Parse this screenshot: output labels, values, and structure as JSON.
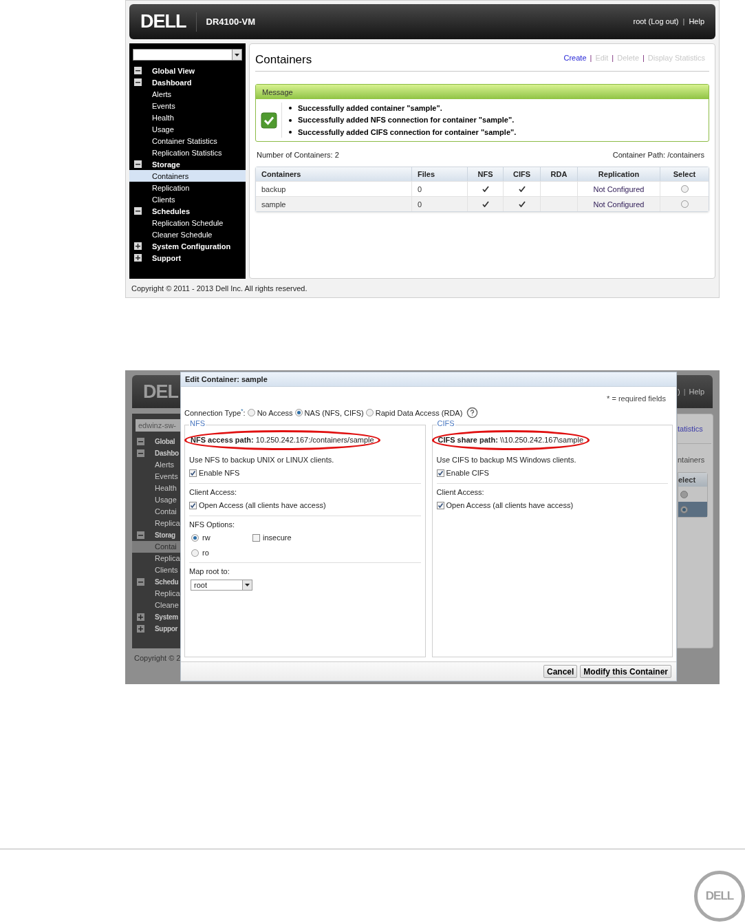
{
  "main_screenshot": {
    "header": {
      "logo": "DELL",
      "product": "DR4100-VM",
      "links": [
        {
          "kind": "link",
          "label": "root (Log out)"
        },
        {
          "kind": "separator",
          "label": "|"
        },
        {
          "kind": "link",
          "label": "Help"
        }
      ]
    },
    "sidebar": {
      "tree": [
        {
          "label": "Global View",
          "expanded": true,
          "selected": false
        },
        {
          "label": "Dashboard",
          "expanded": true,
          "selected": false,
          "children": [
            {
              "label": "Alerts",
              "selected": false
            },
            {
              "label": "Events",
              "selected": false
            },
            {
              "label": "Health",
              "selected": false
            },
            {
              "label": "Usage",
              "selected": false
            },
            {
              "label": "Container Statistics",
              "selected": false
            },
            {
              "label": "Replication Statistics",
              "selected": false
            }
          ]
        },
        {
          "label": "Storage",
          "expanded": true,
          "selected": false,
          "children": [
            {
              "label": "Containers",
              "selected": true
            },
            {
              "label": "Replication",
              "selected": false
            },
            {
              "label": "Clients",
              "selected": false
            }
          ]
        },
        {
          "label": "Schedules",
          "expanded": true,
          "selected": false,
          "children": [
            {
              "label": "Replication Schedule",
              "selected": false
            },
            {
              "label": "Cleaner Schedule",
              "selected": false
            }
          ]
        },
        {
          "label": "System Configuration",
          "expanded": false,
          "selected": false
        },
        {
          "label": "Support",
          "expanded": false,
          "selected": false
        }
      ]
    },
    "content": {
      "title": "Containers",
      "actions": [
        {
          "kind": "link",
          "label": "Create",
          "disabled": false
        },
        {
          "kind": "separator",
          "label": "|"
        },
        {
          "kind": "link",
          "label": "Edit",
          "disabled": true
        },
        {
          "kind": "separator",
          "label": "|"
        },
        {
          "kind": "link",
          "label": "Delete",
          "disabled": true
        },
        {
          "kind": "separator",
          "label": "|"
        },
        {
          "kind": "link",
          "label": "Display Statistics",
          "disabled": true
        }
      ],
      "message": {
        "title": "Message",
        "items": [
          "Successfully added container \"sample\".",
          "Successfully added NFS connection for container \"sample\".",
          "Successfully added CIFS connection for container \"sample\"."
        ]
      },
      "count": "Number of Containers: 2",
      "path": "Container Path: /containers",
      "table": {
        "columns": [
          "Containers",
          "Files",
          "NFS",
          "CIFS",
          "RDA",
          "Replication",
          "Select"
        ],
        "rows": [
          {
            "container": "backup",
            "files": "0",
            "nfs": true,
            "cifs": true,
            "rda": false,
            "replication": "Not Configured",
            "selected": false
          },
          {
            "container": "sample",
            "files": "0",
            "nfs": true,
            "cifs": true,
            "rda": false,
            "replication": "Not Configured",
            "selected": false
          }
        ]
      }
    },
    "copyright": "Copyright © 2011 - 2013 Dell Inc. All rights reserved."
  },
  "dialog_screenshot": {
    "background": {
      "logo": "DEL",
      "dropdown_value": "edwinz-sw-",
      "tree": [
        {
          "label": "Global",
          "expanded": true,
          "selected": false
        },
        {
          "label": "Dashbo",
          "expanded": true,
          "selected": false,
          "children": [
            {
              "label": "Alerts",
              "selected": false
            },
            {
              "label": "Events",
              "selected": false
            },
            {
              "label": "Health",
              "selected": false
            },
            {
              "label": "Usage",
              "selected": false
            },
            {
              "label": "Contai",
              "selected": false
            },
            {
              "label": "Replica",
              "selected": false
            }
          ]
        },
        {
          "label": "Storag",
          "expanded": true,
          "selected": false,
          "children": [
            {
              "label": "Contai",
              "selected": true
            },
            {
              "label": "Replica",
              "selected": false
            },
            {
              "label": "Clients",
              "selected": false
            }
          ]
        },
        {
          "label": "Schedu",
          "expanded": true,
          "selected": false,
          "children": [
            {
              "label": "Replica",
              "selected": false
            },
            {
              "label": "Cleane",
              "selected": false
            }
          ]
        },
        {
          "label": "System",
          "expanded": false,
          "selected": false
        },
        {
          "label": "Suppor",
          "expanded": false,
          "selected": false
        }
      ],
      "copyright": "Copyright © 2",
      "header_links": [
        {
          "kind": "link",
          "label": ")"
        },
        {
          "kind": "separator",
          "label": "|"
        },
        {
          "kind": "link",
          "label": "Help"
        }
      ],
      "actions_fragment": "tatistics",
      "path_fragment": "ntainers",
      "column_fragment": "elect",
      "select_radios": [
        {
          "selected": false
        },
        {
          "selected": true
        }
      ]
    },
    "dialog": {
      "title": "Edit Container: sample",
      "required_note": "* = required fields",
      "connection_type": {
        "label": "Connection Type$^{*}$:",
        "options": [
          {
            "label": "No Access",
            "selected": false
          },
          {
            "label": "NAS (NFS, CIFS)",
            "selected": true
          },
          {
            "label": "Rapid Data Access (RDA)",
            "selected": false
          }
        ]
      },
      "panels": [
        {
          "legend": "NFS",
          "path": "**NFS access path:** 10.250.242.167:/containers/sample",
          "sections": [
            [
              {
                "kind": "text",
                "label": "Use NFS to backup UNIX or LINUX clients."
              },
              {
                "kind": "checkbox",
                "label": "Enable NFS",
                "checked": true
              }
            ],
            [
              {
                "kind": "text",
                "label": "Client Access:"
              },
              {
                "kind": "checkbox",
                "label": "Open Access (all clients have access)",
                "checked": true
              }
            ],
            [
              {
                "kind": "text",
                "label": "NFS Options:"
              },
              {
                "kind": "options",
                "radios": [
                  {
                    "label": "rw",
                    "selected": true
                  },
                  {
                    "label": "ro",
                    "selected": false
                  }
                ],
                "checkbox": {
                  "label": "insecure",
                  "checked": false
                }
              }
            ],
            [
              {
                "kind": "text",
                "label": "Map root to:"
              },
              {
                "kind": "select",
                "value": "root"
              }
            ]
          ]
        },
        {
          "legend": "CIFS",
          "path": "**CIFS share path:** \\\\10.250.242.167\\sample",
          "sections": [
            [
              {
                "kind": "text",
                "label": "Use CIFS to backup MS Windows clients."
              },
              {
                "kind": "checkbox",
                "label": "Enable CIFS",
                "checked": true
              }
            ],
            [
              {
                "kind": "text",
                "label": "Client Access:"
              },
              {
                "kind": "checkbox",
                "label": "Open Access (all clients have access)",
                "checked": true
              }
            ]
          ]
        }
      ],
      "buttons": [
        "Cancel",
        "Modify this Container"
      ]
    }
  },
  "page_footer": {
    "logo": "DELL"
  }
}
